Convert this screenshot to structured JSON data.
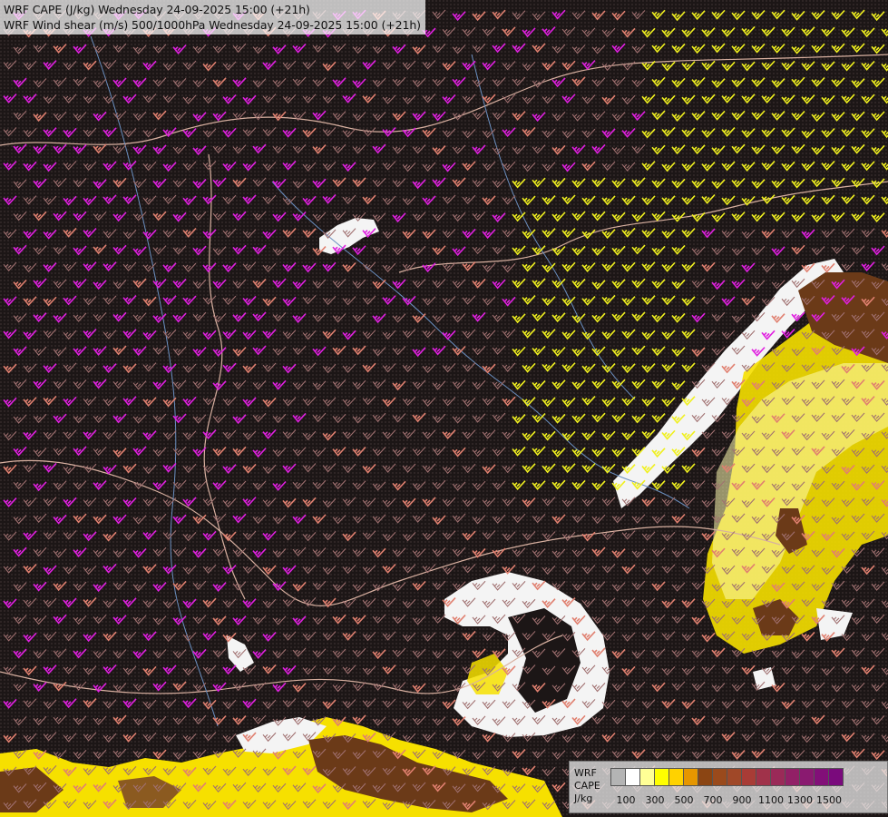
{
  "title": {
    "line1": "WRF CAPE (J/kg) Wednesday 24-09-2025 15:00 (+21h)",
    "line2": "WRF Wind shear (m/s) 500/1000hPa Wednesday 24-09-2025 15:00 (+21h)"
  },
  "legend": {
    "name_line1": "WRF",
    "name_line2": "CAPE",
    "name_line3": "J/kg",
    "colors": [
      "#b4b4b4",
      "#ffffff",
      "#ffff96",
      "#ffff00",
      "#ffd200",
      "#e69600",
      "#8b4513",
      "#9a4a1c",
      "#a04828",
      "#a83c36",
      "#a0324a",
      "#9a2a58",
      "#922066",
      "#8a1a70",
      "#820f78",
      "#7a0a7c"
    ],
    "ticks": [
      "100",
      "300",
      "500",
      "700",
      "900",
      "1100",
      "1300",
      "1500"
    ]
  },
  "map_colors": {
    "background": "#1a1414",
    "barb_magenta": "#e020e0",
    "barb_salmon": "#e08070",
    "barb_yellow": "#f0f020",
    "barb_brown": "#a07070",
    "cape_white": "#f4f4f4",
    "cape_yellow": "#f6e000",
    "cape_brown": "#6b3a18",
    "border": "#d8b0a0",
    "river": "#6a8fc0"
  }
}
